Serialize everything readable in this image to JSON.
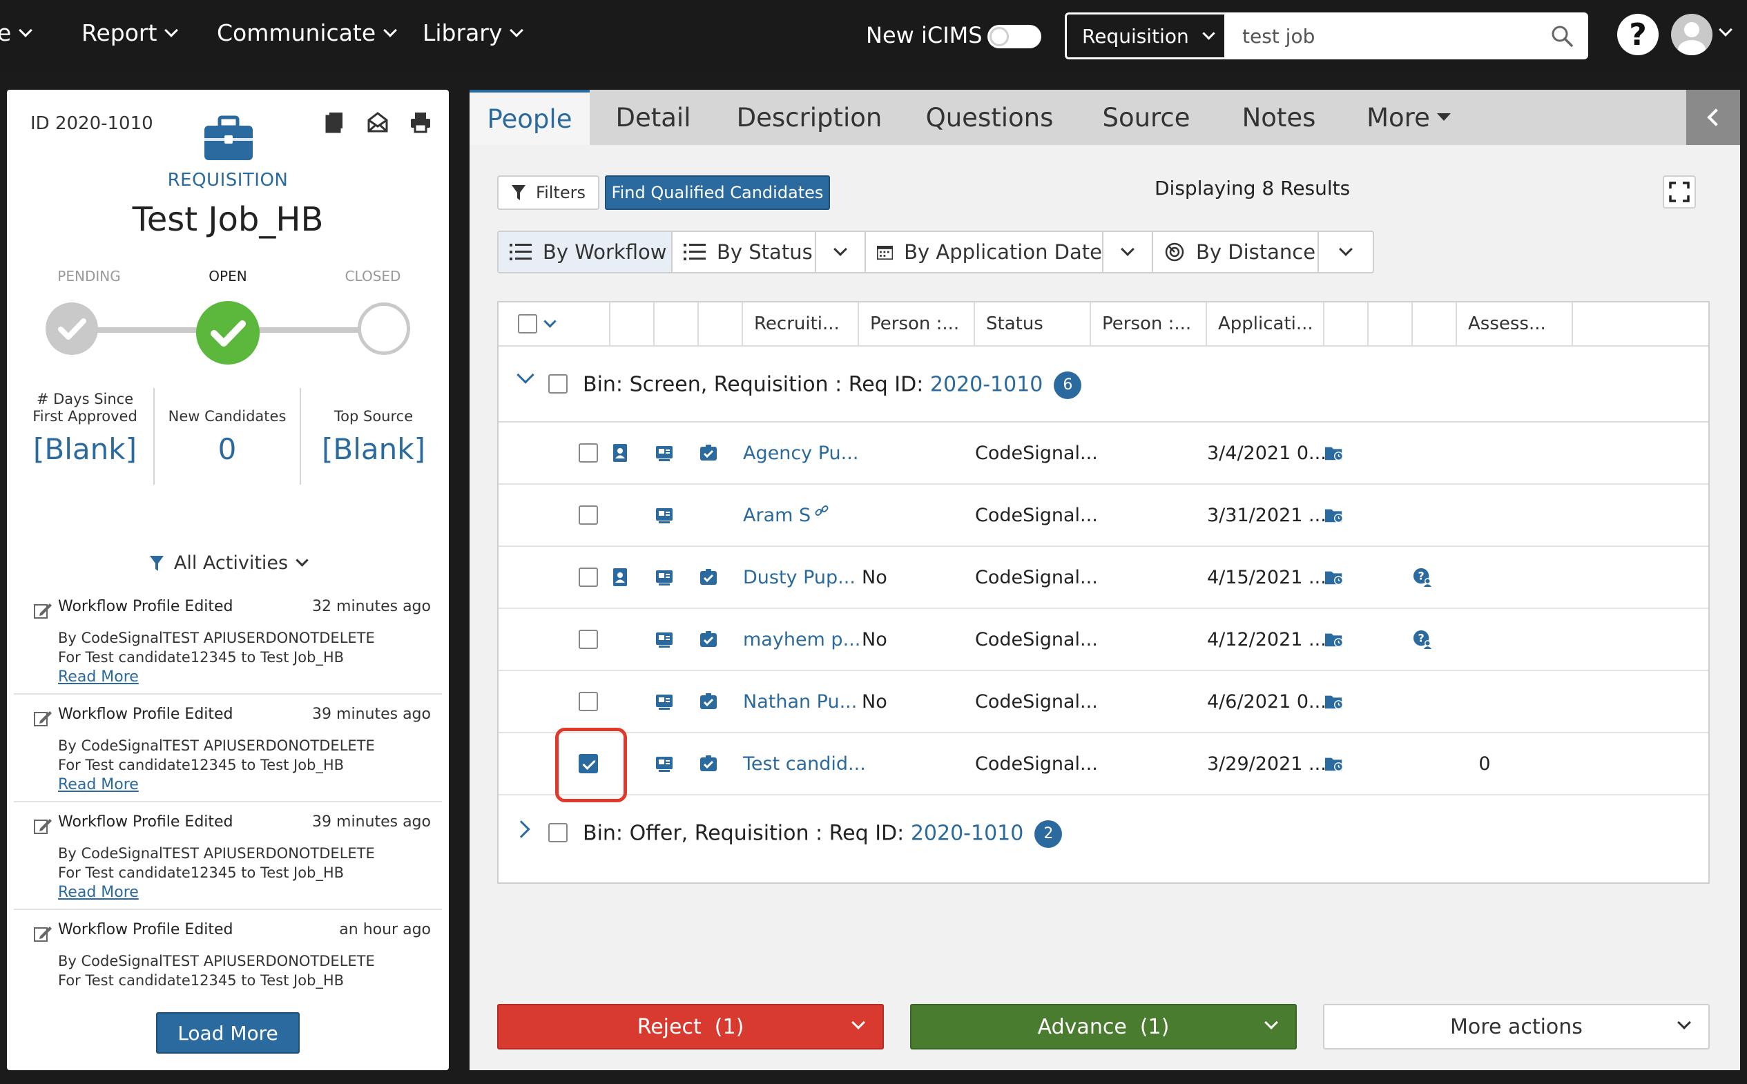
{
  "topnav": {
    "partial_item": "e",
    "items": [
      "Report",
      "Communicate",
      "Library"
    ],
    "toggle_label": "New iCIMS",
    "search_type": "Requisition",
    "search_value": "test job",
    "help": "?"
  },
  "sidebar": {
    "req_id": "ID 2020-1010",
    "req_label": "REQUISITION",
    "job_title": "Test Job_HB",
    "stages": [
      "PENDING",
      "OPEN",
      "CLOSED"
    ],
    "stats": [
      {
        "label": "# Days Since First Approved",
        "label_l1": "# Days Since",
        "label_l2": "First Approved",
        "value": "[Blank]"
      },
      {
        "label": "New Candidates",
        "value": "0"
      },
      {
        "label": "Top Source",
        "value": "[Blank]"
      }
    ],
    "activities_filter": "All Activities",
    "activities": [
      {
        "title": "Workflow Profile Edited",
        "time": "32 minutes ago",
        "line1": "By CodeSignalTEST APIUSERDONOTDELETE",
        "line2": "For Test candidate12345 to Test Job_HB",
        "more": "Read More"
      },
      {
        "title": "Workflow Profile Edited",
        "time": "39 minutes ago",
        "line1": "By CodeSignalTEST APIUSERDONOTDELETE",
        "line2": "For Test candidate12345 to Test Job_HB",
        "more": "Read More"
      },
      {
        "title": "Workflow Profile Edited",
        "time": "39 minutes ago",
        "line1": "By CodeSignalTEST APIUSERDONOTDELETE",
        "line2": "For Test candidate12345 to Test Job_HB",
        "more": "Read More"
      },
      {
        "title": "Workflow Profile Edited",
        "time": "an hour ago",
        "line1": "By CodeSignalTEST APIUSERDONOTDELETE",
        "line2": "For Test candidate12345 to Test Job_HB",
        "more": ""
      }
    ],
    "load_more": "Load More"
  },
  "tabs": [
    "People",
    "Detail",
    "Description",
    "Questions",
    "Source",
    "Notes",
    "More"
  ],
  "toolbar": {
    "filters": "Filters",
    "find_qualified": "Find Qualified Candidates",
    "displaying": "Displaying 8 Results"
  },
  "views": {
    "by_workflow": "By Workflow",
    "by_status": "By Status",
    "by_app_date": "By Application Date",
    "by_distance": "By Distance"
  },
  "grid": {
    "columns": [
      "Recruiti...",
      "Person :...",
      "Status",
      "Person :...",
      "Applicati...",
      "Assess..."
    ],
    "bins": [
      {
        "prefix": "Bin: Screen, Requisition : Req ID: ",
        "req_link": "2020-1010",
        "count": "6"
      },
      {
        "prefix": "Bin: Offer, Requisition : Req ID: ",
        "req_link": "2020-1010",
        "count": "2"
      }
    ],
    "rows": [
      {
        "name": "Agency Pu...",
        "person": "",
        "status": "CodeSignal...",
        "date": "3/4/2021 0...",
        "assess": "",
        "checked": false,
        "has_profile": true,
        "has_check": true,
        "has_question": false,
        "linked": false
      },
      {
        "name": "Aram S",
        "person": "",
        "status": "CodeSignal...",
        "date": "3/31/2021 ...",
        "assess": "",
        "checked": false,
        "has_profile": false,
        "has_check": false,
        "has_question": false,
        "linked": true
      },
      {
        "name": "Dusty Pup...",
        "person": "No",
        "status": "CodeSignal...",
        "date": "4/15/2021 ...",
        "assess": "",
        "checked": false,
        "has_profile": true,
        "has_check": true,
        "has_question": true,
        "linked": false
      },
      {
        "name": "mayhem p...",
        "person": "No",
        "status": "CodeSignal...",
        "date": "4/12/2021 ...",
        "assess": "",
        "checked": false,
        "has_profile": false,
        "has_check": true,
        "has_question": true,
        "linked": false
      },
      {
        "name": "Nathan Pu...",
        "person": "No",
        "status": "CodeSignal...",
        "date": "4/6/2021 0...",
        "assess": "",
        "checked": false,
        "has_profile": false,
        "has_check": true,
        "has_question": false,
        "linked": false
      },
      {
        "name": "Test candid...",
        "person": "",
        "status": "CodeSignal...",
        "date": "3/29/2021 ...",
        "assess": "0",
        "checked": true,
        "has_profile": false,
        "has_check": true,
        "has_question": false,
        "linked": false
      }
    ]
  },
  "actions": {
    "reject": "Reject  (1)",
    "advance": "Advance  (1)",
    "more": "More actions"
  },
  "colors": {
    "accent": "#2b6a9e",
    "reject": "#d93a30",
    "advance": "#4a7c2f",
    "open_stage": "#5cb83c",
    "highlight": "#e0392b"
  }
}
